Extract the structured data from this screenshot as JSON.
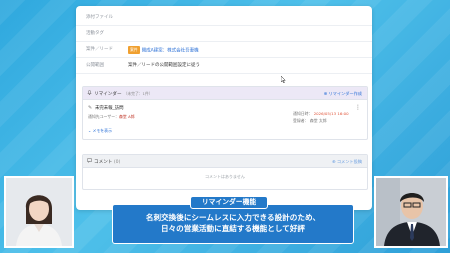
{
  "fields": [
    {
      "label": "添付ファイル",
      "value": ""
    },
    {
      "label": "活動タグ",
      "value": ""
    },
    {
      "label": "案件／リード",
      "tag": "案件",
      "value": "開成A建案：株式会社吾妻機"
    },
    {
      "label": "公開範囲",
      "value": "案件／リードの公開範囲設定に従う"
    }
  ],
  "reminder": {
    "title": "リマインダー",
    "subtitle": "（未完了：1件）",
    "add_label": "リマインダー作成",
    "item_name": "未完未報_訪問",
    "notify_label": "通知先ユーザー：",
    "notify_user": "森堂 A郎",
    "date_label": "通知日時：",
    "date_value": "2026/05/13 16:00",
    "creator_label": "登録者：",
    "creator_value": "森堂 太郎",
    "more_label": "メモを表示"
  },
  "comment": {
    "title": "コメント",
    "count": "(0)",
    "add_label": "コメント投稿",
    "empty_text": "コメントはありません"
  },
  "caption": {
    "tag": "リマインダー機能",
    "line1": "名刺交換後にシームレスに入力できる設計のため、",
    "line2": "日々の営業活動に直結する機能として好評"
  },
  "colors": {
    "background": "#2fa8de",
    "caption_bg": "#2379c9",
    "reminder_header": "#ece8f6",
    "link": "#2a6fd6",
    "accent_orange": "#f0a030"
  },
  "icons": {
    "bell": "bell-icon",
    "comment": "comment-icon",
    "add": "plus-circle-icon",
    "kebab": "kebab-menu-icon",
    "chevron": "chevron-down-icon",
    "cursor": "mouse-pointer-icon"
  }
}
